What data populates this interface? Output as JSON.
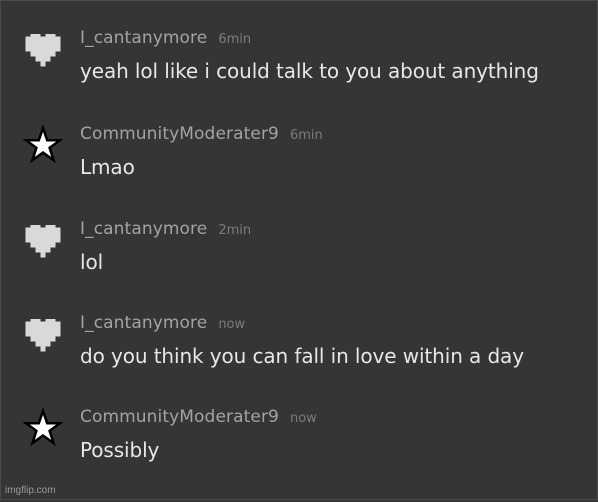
{
  "messages": [
    {
      "username": "I_cantanymore",
      "time": "6min",
      "text": "yeah lol like i could talk to you about anything",
      "avatar_icon": "heart-icon"
    },
    {
      "username": "CommunityModerater9",
      "time": "6min",
      "text": "Lmao",
      "avatar_icon": "star-icon"
    },
    {
      "username": "I_cantanymore",
      "time": "2min",
      "text": "lol",
      "avatar_icon": "heart-icon"
    },
    {
      "username": "I_cantanymore",
      "time": "now",
      "text": "do you think you can fall in love within a day",
      "avatar_icon": "heart-icon"
    },
    {
      "username": "CommunityModerater9",
      "time": "now",
      "text": "Possibly",
      "avatar_icon": "star-icon"
    }
  ],
  "watermark": "imgflip.com",
  "colors": {
    "background": "#353535",
    "username": "#a3a3a3",
    "time": "#7c7c7c",
    "message_text": "#e7e7e7",
    "heart": "#d9d9d9",
    "star_fill": "#ffffff",
    "star_outline": "#000000"
  }
}
